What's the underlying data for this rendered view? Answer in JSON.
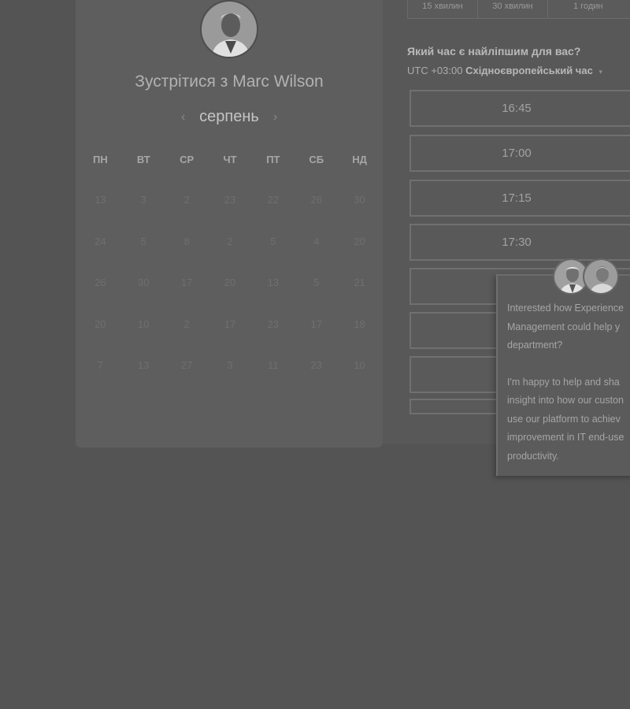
{
  "booking": {
    "title": "Зустрітися з Marc Wilson",
    "prev_month_icon": "‹",
    "next_month_icon": "›",
    "month": "серпень",
    "weekdays": [
      "ПН",
      "ВТ",
      "СР",
      "ЧТ",
      "ПТ",
      "СБ",
      "НД"
    ],
    "days": [
      "13",
      "3",
      "2",
      "23",
      "22",
      "26",
      "30",
      "24",
      "5",
      "8",
      "2",
      "5",
      "4",
      "20",
      "26",
      "30",
      "17",
      "20",
      "13",
      "5",
      "21",
      "20",
      "10",
      "2",
      "17",
      "23",
      "17",
      "18",
      "7",
      "13",
      "27",
      "3",
      "11",
      "23",
      "10"
    ]
  },
  "durations": [
    "15 хвилин",
    "30 хвилин",
    "1 годин"
  ],
  "time_picker": {
    "question": "Який час є найліпшим для вас?",
    "timezone_prefix": "UTC +03:00",
    "timezone_name": "Східноєвропейський час",
    "caret": "▾",
    "slots": [
      "16:45",
      "17:00",
      "17:15",
      "17:30"
    ]
  },
  "chat": {
    "lines_1": [
      "Interested how Experience",
      "Management could help y",
      "department?"
    ],
    "lines_2": [
      "I'm happy to help and sha",
      "insight into how our custon",
      "use our platform to achiev",
      "improvement in IT end-use",
      "productivity."
    ]
  },
  "icons": {
    "host_avatar": "person-avatar-icon",
    "agent_avatar": "agent-avatar-icon",
    "timezone_caret": "chevron-down-icon"
  }
}
